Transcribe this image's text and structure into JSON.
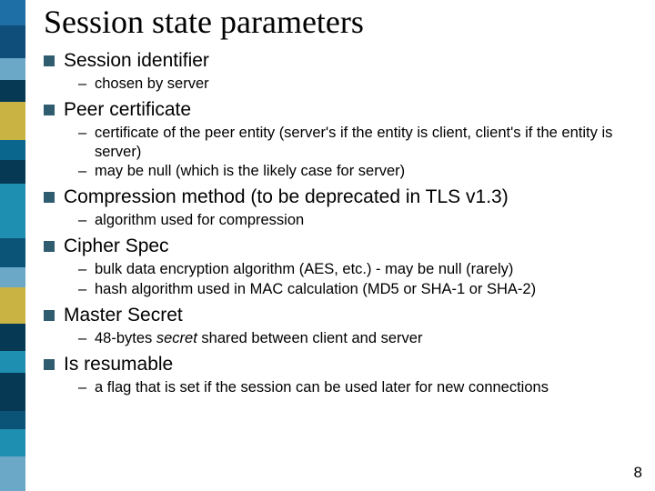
{
  "title": "Session state parameters",
  "page_number": "8",
  "stripe_colors": [
    "#1d6fa5",
    "#0f4d7a",
    "#6ba7c7",
    "#063a54",
    "#c9b443",
    "#0b668e",
    "#063a54",
    "#1f8fb1",
    "#1f8fb1",
    "#0b5478",
    "#6ba7c7",
    "#c9b443",
    "#063a54",
    "#1f8fb1",
    "#063a54",
    "#0b5478",
    "#1f8fb1",
    "#6ba7c7"
  ],
  "stripe_heights": [
    28,
    36,
    24,
    24,
    42,
    22,
    26,
    44,
    16,
    32,
    22,
    40,
    30,
    24,
    42,
    20,
    30,
    38
  ],
  "items": [
    {
      "title": "Session identifier",
      "subs": [
        {
          "text": "chosen by server"
        }
      ]
    },
    {
      "title": "Peer certificate",
      "subs": [
        {
          "text": "certificate of the peer entity (server's if the entity is client, client's if the entity is server)"
        },
        {
          "text": "may be null (which is the likely case for server)"
        }
      ]
    },
    {
      "title": "Compression method (to be deprecated in TLS v1.3)",
      "subs": [
        {
          "text": "algorithm used for compression"
        }
      ]
    },
    {
      "title": "Cipher Spec",
      "subs": [
        {
          "text": "bulk data encryption algorithm (AES, etc.) - may be null (rarely)"
        },
        {
          "text": "hash algorithm used in MAC calculation (MD5 or SHA-1 or SHA-2)"
        }
      ]
    },
    {
      "title": "Master Secret",
      "subs": [
        {
          "html": "48-bytes <i>secret</i> shared between client and server"
        }
      ]
    },
    {
      "title": "Is resumable",
      "subs": [
        {
          "text": "a flag that is set if the session can be used later for new connections"
        }
      ]
    }
  ]
}
